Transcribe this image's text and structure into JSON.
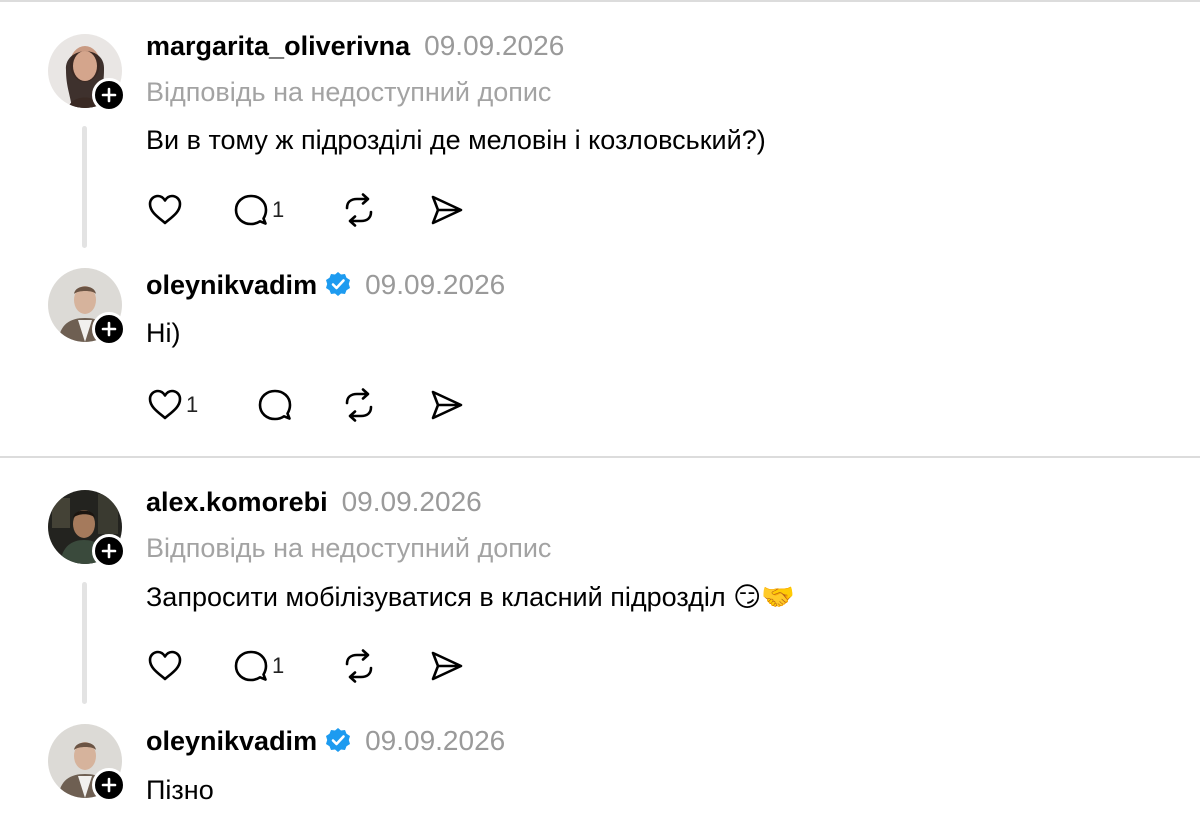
{
  "comments": [
    {
      "username": "margarita_oliverivna",
      "verified": false,
      "date": "09.09.2026",
      "reply_note": "Відповідь на недоступний допис",
      "text": "Ви в тому ж підрозділі де меловін і козловський?)",
      "likes": "",
      "replies": "1"
    },
    {
      "username": "oleynikvadim",
      "verified": true,
      "date": "09.09.2026",
      "reply_note": "",
      "text": "Ні)",
      "likes": "1",
      "replies": ""
    },
    {
      "username": "alex.komorebi",
      "verified": false,
      "date": "09.09.2026",
      "reply_note": "Відповідь на недоступний допис",
      "text": "Запросити мобілізуватися в класний підрозділ 😏🤝",
      "likes": "",
      "replies": "1"
    },
    {
      "username": "oleynikvadim",
      "verified": true,
      "date": "09.09.2026",
      "reply_note": "",
      "text": "Пізно"
    }
  ],
  "colors": {
    "text": "#000000",
    "muted": "#9a9a9a",
    "verified_badge": "#1d9bf0",
    "divider": "#dcdcdc"
  },
  "icons": [
    "heart-icon",
    "comment-icon",
    "repost-icon",
    "share-icon",
    "plus-icon",
    "verified-badge-icon"
  ]
}
